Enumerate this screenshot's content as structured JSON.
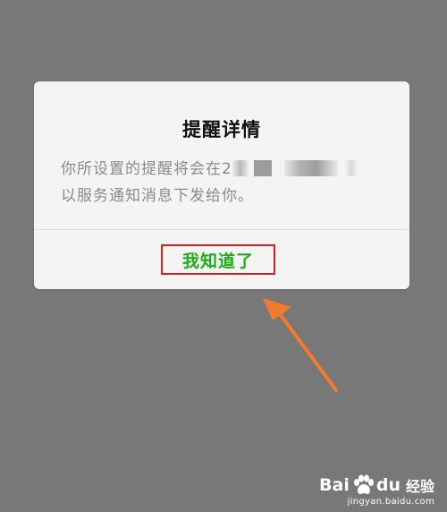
{
  "dialog": {
    "title": "提醒详情",
    "message": {
      "line1_visible": "你所设置的提醒将会在2",
      "line2": "以服务通知消息下发给你。"
    },
    "confirm_label": "我知道了"
  },
  "colors": {
    "backdrop": "#787878",
    "dialog_bg": "#f4f4f4",
    "confirm_text": "#1aad19",
    "highlight_box": "#d42020",
    "arrow": "#f47a2b"
  },
  "watermark": {
    "brand_left": "Bai",
    "brand_right": "du",
    "product": "经验",
    "url": "jingyan.baidu.com"
  }
}
